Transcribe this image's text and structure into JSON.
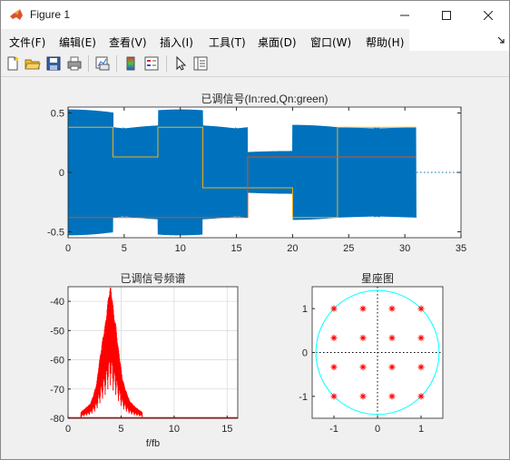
{
  "window": {
    "title": "Figure 1"
  },
  "menu": [
    "文件(F)",
    "编辑(E)",
    "查看(V)",
    "插入(I)",
    "工具(T)",
    "桌面(D)",
    "窗口(W)",
    "帮助(H)"
  ],
  "toolbar": [
    "new-figure",
    "open-file",
    "save",
    "print",
    "link-plot",
    "insert-colorbar",
    "insert-legend",
    "edit-plot",
    "property-inspector"
  ],
  "colors": {
    "signal": "#0072bd",
    "in": "#d95319",
    "qn": "#edb120",
    "spectrum": "#ff0000",
    "circle": "#00ffff",
    "points": "#ff0000"
  },
  "chart_data": [
    {
      "type": "line",
      "title": "已调信号(In:red,Qn:green)",
      "xlabel": "",
      "ylabel": "",
      "xlim": [
        0,
        35
      ],
      "ylim": [
        -0.55,
        0.55
      ],
      "xticks": [
        "0",
        "5",
        "10",
        "15",
        "20",
        "25",
        "30",
        "35"
      ],
      "yticks": [
        "0.5",
        "0",
        "-0.5"
      ],
      "grid": false,
      "segments": [
        {
          "t0": 0,
          "t1": 4,
          "in": -0.38,
          "qn": 0.38,
          "amp": 0.53
        },
        {
          "t0": 4,
          "t1": 8,
          "in": -0.38,
          "qn": 0.13,
          "amp": 0.4
        },
        {
          "t0": 8,
          "t1": 12,
          "in": -0.38,
          "qn": 0.38,
          "amp": 0.53
        },
        {
          "t0": 12,
          "t1": 16,
          "in": -0.38,
          "qn": -0.13,
          "amp": 0.4
        },
        {
          "t0": 16,
          "t1": 20,
          "in": 0.13,
          "qn": -0.13,
          "amp": 0.18
        },
        {
          "t0": 20,
          "t1": 24,
          "in": 0.13,
          "qn": -0.38,
          "amp": 0.4
        },
        {
          "t0": 24,
          "t1": 31,
          "in": 0.13,
          "qn": 0.38,
          "amp": 0.4
        }
      ]
    },
    {
      "type": "line",
      "title": "已调信号频谱",
      "xlabel": "f/fb",
      "ylabel": "",
      "xlim": [
        0,
        16
      ],
      "ylim": [
        -80,
        -35
      ],
      "xticks": [
        "0",
        "5",
        "10",
        "15"
      ],
      "yticks": [
        "-40",
        "-50",
        "-60",
        "-70",
        "-80"
      ],
      "grid": true,
      "peak_x": 4,
      "peak_y": -35,
      "sidelobes": [
        [
          1.2,
          -78
        ],
        [
          1.5,
          -77
        ],
        [
          2.1,
          -75
        ],
        [
          2.4,
          -72
        ],
        [
          2.7,
          -68
        ],
        [
          2.9,
          -62
        ],
        [
          3.1,
          -57
        ],
        [
          3.3,
          -52
        ],
        [
          3.5,
          -48
        ],
        [
          3.7,
          -42
        ],
        [
          3.85,
          -37
        ],
        [
          4.0,
          -35
        ],
        [
          4.15,
          -38
        ],
        [
          4.3,
          -44
        ],
        [
          4.5,
          -48
        ],
        [
          4.7,
          -55
        ],
        [
          4.9,
          -60
        ],
        [
          5.1,
          -66
        ],
        [
          5.4,
          -70
        ],
        [
          5.8,
          -74
        ],
        [
          6.3,
          -76
        ],
        [
          7.0,
          -78
        ]
      ]
    },
    {
      "type": "scatter",
      "title": "星座图",
      "xlabel": "",
      "ylabel": "",
      "xlim": [
        -1.5,
        1.5
      ],
      "ylim": [
        -1.5,
        1.5
      ],
      "xticks": [
        "-1",
        "0",
        "1"
      ],
      "yticks": [
        "1",
        "0",
        "-1"
      ],
      "grid": false,
      "circle_radius": 1.414,
      "points": [
        [
          -1,
          1
        ],
        [
          -0.333,
          1
        ],
        [
          0.333,
          1
        ],
        [
          1,
          1
        ],
        [
          -1,
          0.333
        ],
        [
          -0.333,
          0.333
        ],
        [
          0.333,
          0.333
        ],
        [
          1,
          0.333
        ],
        [
          -1,
          -0.333
        ],
        [
          -0.333,
          -0.333
        ],
        [
          0.333,
          -0.333
        ],
        [
          1,
          -0.333
        ],
        [
          -1,
          -1
        ],
        [
          -0.333,
          -1
        ],
        [
          0.333,
          -1
        ],
        [
          1,
          -1
        ]
      ]
    }
  ]
}
